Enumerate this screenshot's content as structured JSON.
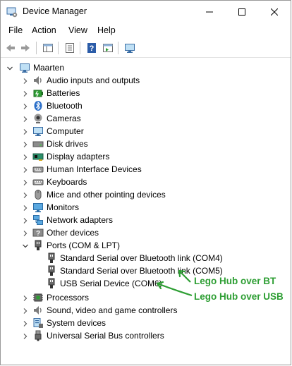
{
  "window": {
    "title": "Device Manager"
  },
  "menu": {
    "file": "File",
    "action": "Action",
    "view": "View",
    "help": "Help"
  },
  "tree": {
    "root": "Maarten",
    "categories": [
      "Audio inputs and outputs",
      "Batteries",
      "Bluetooth",
      "Cameras",
      "Computer",
      "Disk drives",
      "Display adapters",
      "Human Interface Devices",
      "Keyboards",
      "Mice and other pointing devices",
      "Monitors",
      "Network adapters",
      "Other devices",
      "Ports (COM & LPT)",
      "Processors",
      "Sound, video and game controllers",
      "System devices",
      "Universal Serial Bus controllers"
    ],
    "ports_children": [
      "Standard Serial over Bluetooth link (COM4)",
      "Standard Serial over Bluetooth link (COM5)",
      "USB Serial Device (COM6)"
    ]
  },
  "annotations": {
    "bt": "Lego Hub over BT",
    "usb": "Lego Hub over USB"
  },
  "colors": {
    "annotation": "#2d9e33"
  }
}
